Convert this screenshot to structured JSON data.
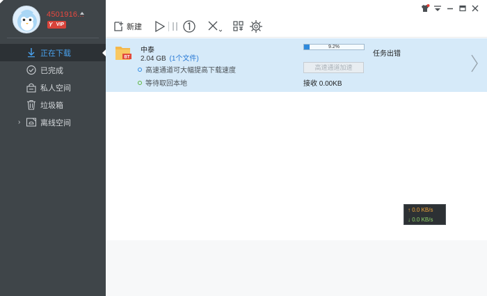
{
  "user": {
    "name": "4501916...",
    "vip_label": "VIP",
    "vip_level": "Y"
  },
  "sidebar": {
    "items": [
      {
        "label": "正在下载",
        "icon": "download-arrow-icon",
        "active": true
      },
      {
        "label": "已完成",
        "icon": "check-circle-icon",
        "active": false
      },
      {
        "label": "私人空间",
        "icon": "lock-box-icon",
        "active": false
      },
      {
        "label": "垃圾箱",
        "icon": "trash-icon",
        "active": false
      },
      {
        "label": "离线空间",
        "icon": "cloud-folder-icon",
        "active": false,
        "expandable": true
      }
    ]
  },
  "toolbar": {
    "new_label": "新建",
    "buttons": [
      "new-icon",
      "play-icon",
      "pause-icon",
      "limit-speed-icon",
      "delete-icon",
      "grid-icon",
      "settings-gear-icon"
    ]
  },
  "window_controls": [
    "shirt-skin-icon",
    "menu-icon",
    "minimize-icon",
    "maximize-icon",
    "close-icon"
  ],
  "task": {
    "name": "中泰",
    "size": "2.04 GB",
    "files": "(1个文件)",
    "tip_accelerate": "高速通道可大幅提高下载速度",
    "tip_waiting": "等待取回本地",
    "progress_text": "9.2%",
    "progress_value": 0.092,
    "status": "任务出错",
    "accelerate_button": "高速通道加速",
    "received": "接收 0.00KB",
    "file_type_badge": "BT"
  },
  "speed_widget": {
    "upload": "↑ 0.0 KB/s",
    "download": "↓ 0.0 KB/s"
  },
  "colors": {
    "sidebar_bg": "#3f4549",
    "active_blue": "#4aa3f0",
    "task_row_bg": "#d6eaf9",
    "username_red": "#e8483f"
  }
}
